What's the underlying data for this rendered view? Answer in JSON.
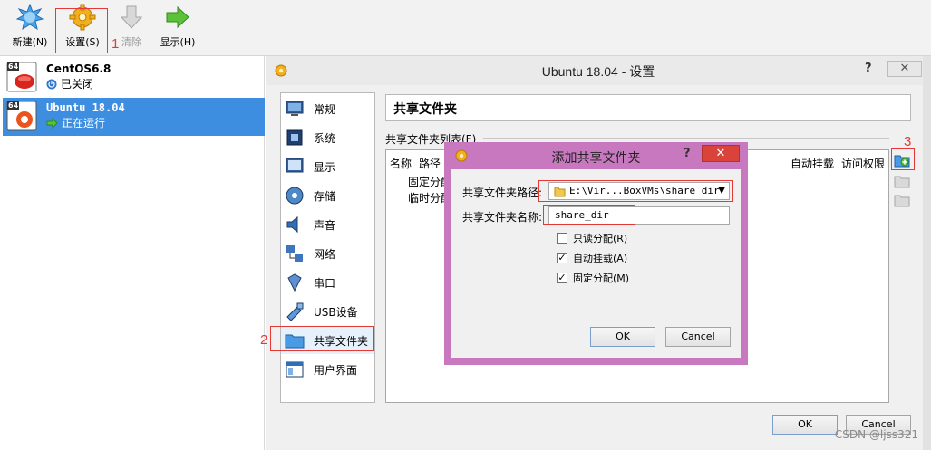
{
  "toolbar": {
    "new_label": "新建(N)",
    "settings_label": "设置(S)",
    "discard_label": "清除",
    "show_label": "显示(H)"
  },
  "annotations": {
    "step1": "1",
    "step2": "2",
    "step3": "3"
  },
  "vm_list": [
    {
      "name": "CentOS6.8",
      "status": "已关闭",
      "badge": "64"
    },
    {
      "name": "Ubuntu 18.04",
      "status": "正在运行",
      "badge": "64"
    }
  ],
  "settings_window": {
    "title": "Ubuntu 18.04 - 设置",
    "help": "?",
    "close": "✕",
    "categories": [
      "常规",
      "系统",
      "显示",
      "存储",
      "声音",
      "网络",
      "串口",
      "USB设备",
      "共享文件夹",
      "用户界面"
    ],
    "selected_category": "共享文件夹",
    "page_title": "共享文件夹",
    "list_label": "共享文件夹列表(F)",
    "columns": {
      "name": "名称",
      "path": "路径",
      "auto_mount": "自动挂载",
      "access": "访问权限"
    },
    "tree_rows": [
      "固定分配",
      "临时分配"
    ],
    "ok_label": "OK",
    "cancel_label": "Cancel"
  },
  "add_dialog": {
    "title": "添加共享文件夹",
    "help": "?",
    "close": "✕",
    "path_label": "共享文件夹路径:",
    "path_value": "E:\\Vir...BoxVMs\\share_dir",
    "name_label": "共享文件夹名称:",
    "name_value": "share_dir",
    "readonly_label": "只读分配(R)",
    "readonly_checked": false,
    "automount_label": "自动挂载(A)",
    "automount_checked": true,
    "permanent_label": "固定分配(M)",
    "permanent_checked": true,
    "ok_label": "OK",
    "cancel_label": "Cancel"
  },
  "watermark": "CSDN @ljss321",
  "colors": {
    "selection": "#3d8ee0",
    "dialog_frame": "#c778bf",
    "annotation": "#e53935"
  }
}
